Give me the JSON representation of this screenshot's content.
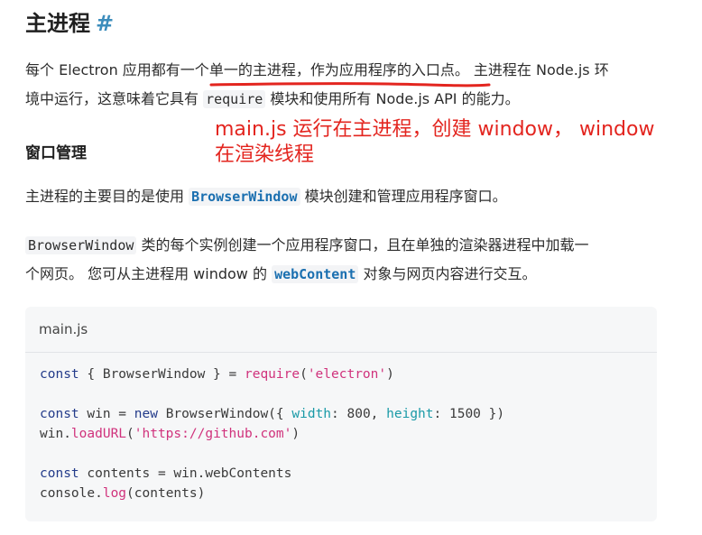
{
  "heading": {
    "title": "主进程",
    "hash": "#"
  },
  "para1": {
    "line1_a": "每个 Electron 应用都有一个",
    "line1_b": "单一的主进程，作为应用程序的入口点",
    "line1_c": "。 主进程在 Node.js 环",
    "line2_a": "境中运行，这意味着它具有 ",
    "line2_code": "require",
    "line2_b": " 模块和使用所有 Node.js API 的能力。"
  },
  "annotation": {
    "line1": "main.js 运行在主进程，创建 window， window",
    "line2": "在渲染线程"
  },
  "subheading": "窗口管理",
  "para2": {
    "a": "主进程的主要目的是使用 ",
    "code": "BrowserWindow",
    "b": " 模块创建和管理应用程序窗口。"
  },
  "para3": {
    "line1_code": "BrowserWindow",
    "line1_b": " 类的每个实例创建一个应用程序窗口，且在单独的渲染器进程中加载一",
    "line2_a": "个网页。 您可从主进程用 window 的 ",
    "line2_code": "webContent",
    "line2_b": " 对象与网页内容进行交互。"
  },
  "codeblock": {
    "filename": "main.js",
    "l1": {
      "kw": "const",
      "a": " { BrowserWindow } = ",
      "fn": "require",
      "b": "(",
      "str": "'electron'",
      "c": ")"
    },
    "l2": {
      "kw": "const",
      "a": " win = ",
      "kw2": "new",
      "b": " BrowserWindow({ ",
      "p1": "width",
      "c": ": 800, ",
      "p2": "height",
      "d": ": 1500 })"
    },
    "l3": {
      "a": "win.",
      "fn": "loadURL",
      "b": "(",
      "str": "'https://github.com'",
      "c": ")"
    },
    "l4": {
      "kw": "const",
      "a": " contents = win.webContents"
    },
    "l5": {
      "a": "console.",
      "fn": "log",
      "b": "(contents)"
    }
  },
  "colors": {
    "annotation": "#e3251f",
    "link": "#1a6fb0",
    "heading_hash": "#3c8dbc"
  }
}
